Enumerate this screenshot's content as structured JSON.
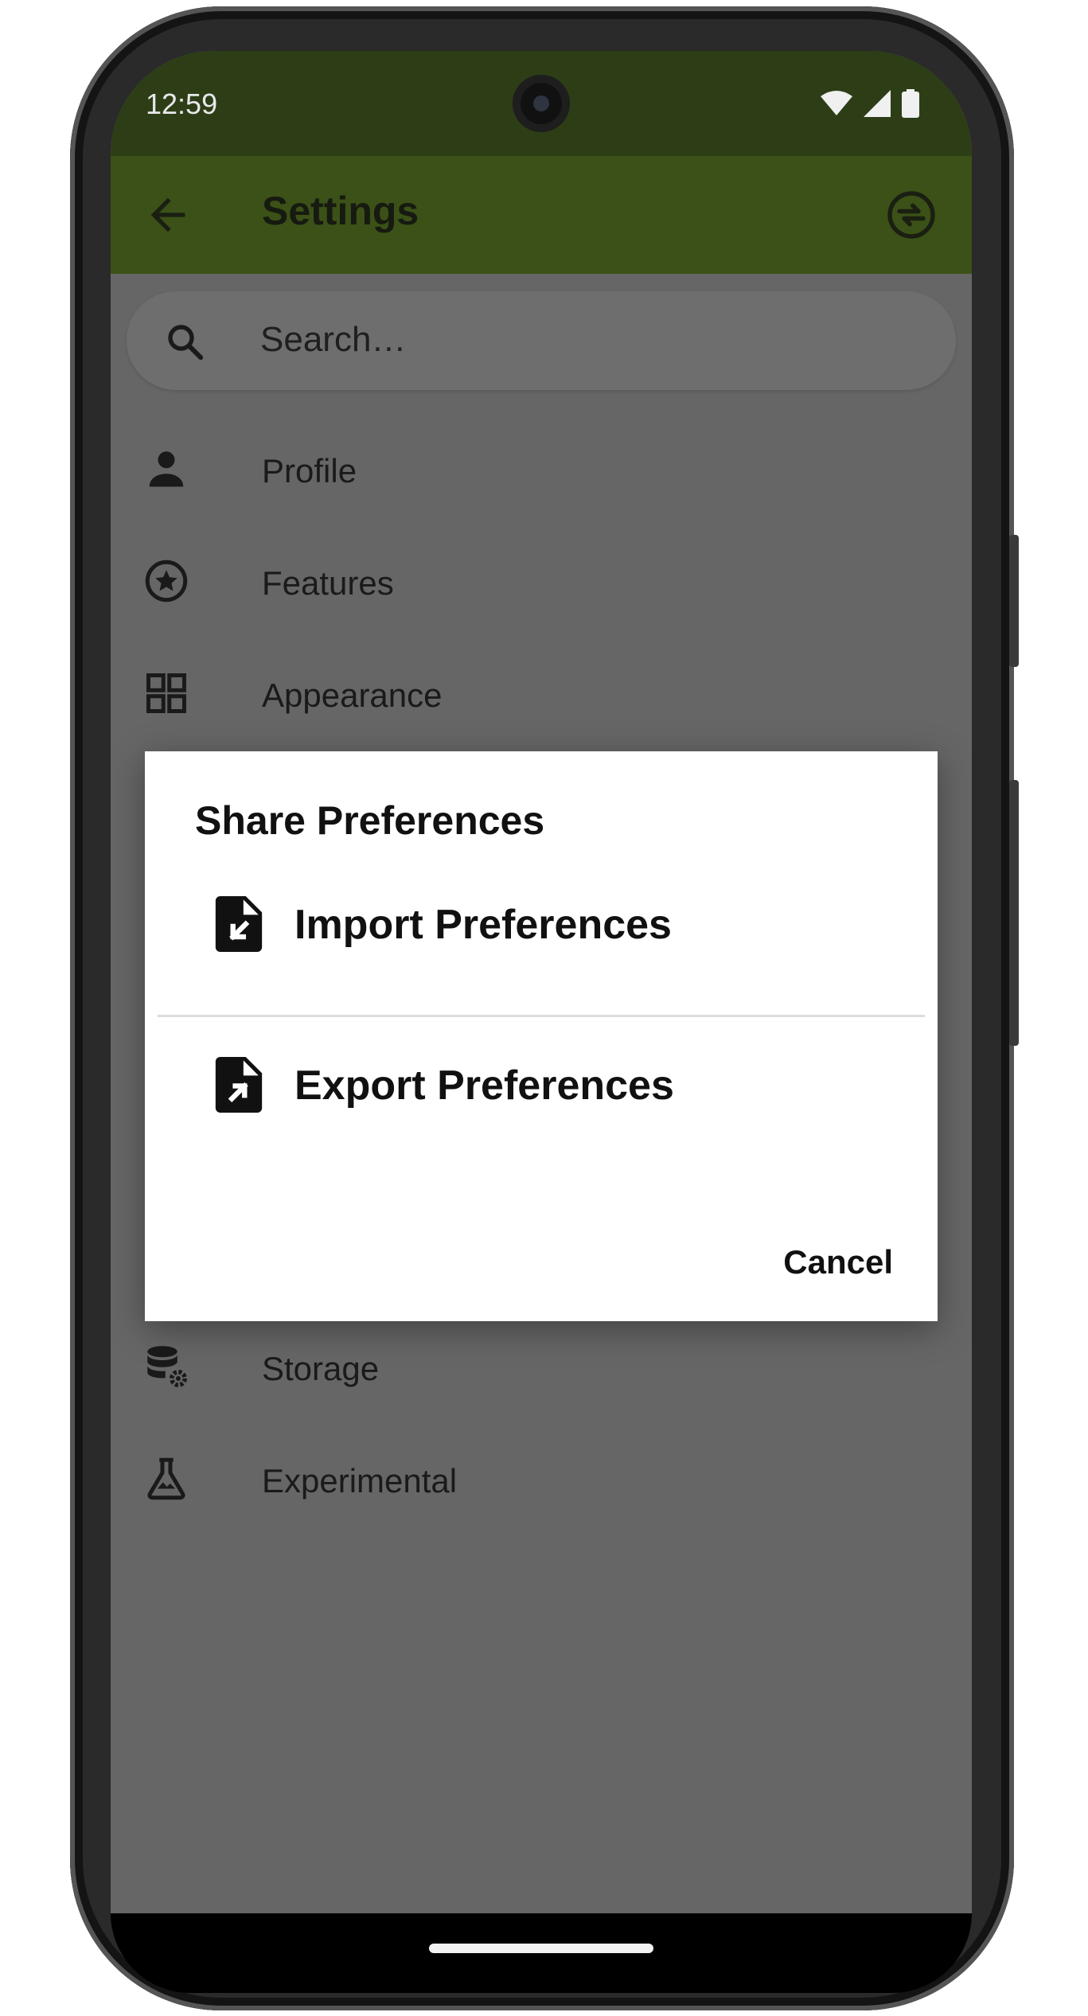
{
  "status_bar": {
    "time": "12:59",
    "icons": [
      "wifi-icon",
      "signal-icon",
      "battery-icon"
    ]
  },
  "app_bar": {
    "title": "Settings",
    "back_icon": "arrow-back-icon",
    "action_icon": "share-preferences-icon"
  },
  "search": {
    "placeholder": "Search…",
    "icon": "search-icon"
  },
  "menu": {
    "items": [
      {
        "label": "Profile",
        "icon": "person-icon"
      },
      {
        "label": "Features",
        "icon": "star-circle-icon"
      },
      {
        "label": "Appearance",
        "icon": "grid-icon"
      },
      {
        "label": "Storage",
        "icon": "database-gear-icon"
      },
      {
        "label": "Experimental",
        "icon": "flask-icon"
      }
    ]
  },
  "dialog": {
    "title": "Share Preferences",
    "options": [
      {
        "label": "Import Preferences",
        "icon": "file-import-icon"
      },
      {
        "label": "Export Preferences",
        "icon": "file-export-icon"
      }
    ],
    "cancel_label": "Cancel"
  },
  "colors": {
    "status_bar": "#2d3e17",
    "app_bar": "#3b5117",
    "scrim_background": "#666666",
    "dialog_background": "#ffffff"
  }
}
